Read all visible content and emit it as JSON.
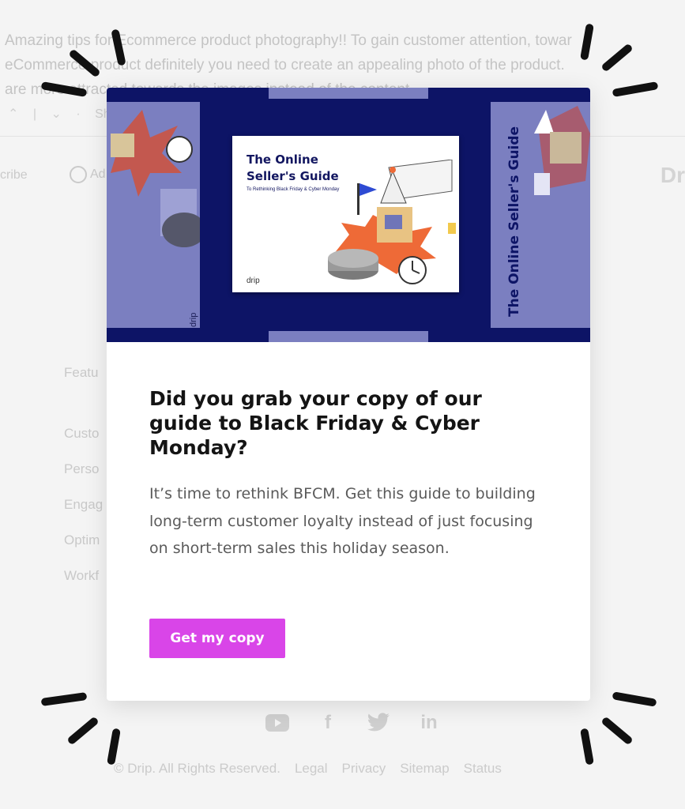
{
  "background": {
    "article_lines": [
      "Amazing tips for Ecommerce product photography!! To gain customer attention, towar",
      "eCommerce product definitely you need to create an appealing photo of the product.",
      "are more attracted towards the images instead of the content"
    ],
    "action_share": "Sha",
    "subscribe": "cribe",
    "ad_label": "Ad",
    "right_logo": "Dr",
    "nav_items": [
      "Featu",
      "Custo",
      "Perso",
      "Engag",
      "Optim",
      "Workf"
    ],
    "social_icons": [
      "youtube-icon",
      "facebook-icon",
      "twitter-icon",
      "linkedin-icon"
    ],
    "footer": {
      "copyright": "© Drip. All Rights Reserved.",
      "links": [
        "Legal",
        "Privacy",
        "Sitemap",
        "Status"
      ]
    }
  },
  "modal": {
    "book": {
      "title": "The Online\nSeller's Guide",
      "subtitle": "To Rethinking Black Friday & Cyber Monday",
      "brand": "drip",
      "side_title": "The Online Seller's Guide"
    },
    "heading": "Did you grab your copy of our guide to Black Friday & Cyber Monday?",
    "body": "It’s time to rethink BFCM. Get this guide to building long-term customer loyalty instead of just focusing on short-term sales this holiday season.",
    "cta_label": "Get my copy",
    "colors": {
      "hero_bg": "#0d1466",
      "cta_bg": "#d945e8",
      "cover_panels": "#7b7fc0"
    }
  }
}
